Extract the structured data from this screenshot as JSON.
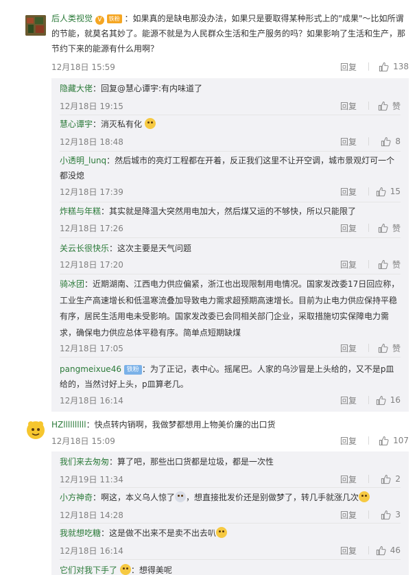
{
  "comments": [
    {
      "username": "后人类视觉",
      "badge_fan": "铁粉",
      "text": "：如果真的是缺电那没办法，如果只是要取得某种形式上的\"成果\"～比如所谓的节能，就莫名其妙了。能源不就是为人民群众生活和生产服务的吗？如果影响了生活和生产，那节约下来的能源有什么用啊？",
      "time": "12月18日 15:59",
      "reply_label": "回复",
      "likes": "138",
      "replies": [
        {
          "username": "隐藏大佬",
          "text": "：回复@慧心谭宇:有内味道了",
          "time": "12月18日 19:15",
          "reply_label": "回复",
          "likes": "赞"
        },
        {
          "username": "慧心谭宇",
          "text": "：消灭私有化",
          "time": "12月18日 18:48",
          "reply_label": "回复",
          "likes": "8"
        },
        {
          "username": "小透明_lunq",
          "text": "：然后城市的亮灯工程都在开着，反正我们这里不让开空调，城市景观灯可一个都没熄",
          "time": "12月18日 17:39",
          "reply_label": "回复",
          "likes": "15"
        },
        {
          "username": "炸糕与年糕",
          "text": "：其实就是降温大突然用电加大，然后煤又运的不够快，所以只能限了",
          "time": "12月18日 17:26",
          "reply_label": "回复",
          "likes": "赞"
        },
        {
          "username": "关云长很快乐",
          "text": "：这次主要是天气问题",
          "time": "12月18日 17:20",
          "reply_label": "回复",
          "likes": "赞"
        },
        {
          "username": "骑冰团",
          "text": "：近期湖南、江西电力供应偏紧，浙江也出现限制用电情况。国家发改委17日回应称，工业生产高速增长和低温寒流叠加导致电力需求超预期高速增长。目前为止电力供应保持平稳有序，居民生活用电未受影响。国家发改委已会同相关部门企业，采取措施切实保障电力需求，确保电力供应总体平稳有序。简单点短期缺煤",
          "time": "12月18日 17:05",
          "reply_label": "回复",
          "likes": "赞"
        },
        {
          "username": "pangmeixue46",
          "badge_ironfan": "铁粉",
          "text": "：为了正记，表中心。摇尾巴。人家的乌沙冒是上头给的，又不是p皿给的，当然讨好上头，p皿算老几。",
          "time": "12月18日 16:14",
          "reply_label": "回复",
          "likes": "16"
        }
      ]
    },
    {
      "username": "HZllllllllll",
      "text": "：快点转内销啊，我做梦都想用上物美价廉的出口货",
      "time": "12月18日 15:09",
      "reply_label": "回复",
      "likes": "107",
      "replies": [
        {
          "username": "我们来去匆匆",
          "text": "：算了吧，那些出口货都是垃圾，都是一次性",
          "time": "12月19日 11:34",
          "reply_label": "回复",
          "likes": "2"
        },
        {
          "username": "小方神奇",
          "text": "：啊这，本义乌人惊了",
          "text2": "，想直接批发价还是别做梦了，转几手就涨几次",
          "time": "12月18日 14:28",
          "reply_label": "回复",
          "likes": "3"
        },
        {
          "username": "我就想吃糖",
          "text": "：这是做不出来不是卖不出去叭",
          "time": "12月18日 16:14",
          "reply_label": "回复",
          "likes": "46"
        },
        {
          "username": "它们对我下手了",
          "text": "：想得美呢"
        }
      ]
    }
  ],
  "colors": {
    "username": "#2b7a39",
    "meta": "#808080",
    "panel": "#f2f2f5",
    "badge": "#f5a623",
    "ironfan": "#7ab1e8"
  },
  "icons": {
    "like": "thumbs-up-icon",
    "emoji": "smile-emoji-icon"
  }
}
